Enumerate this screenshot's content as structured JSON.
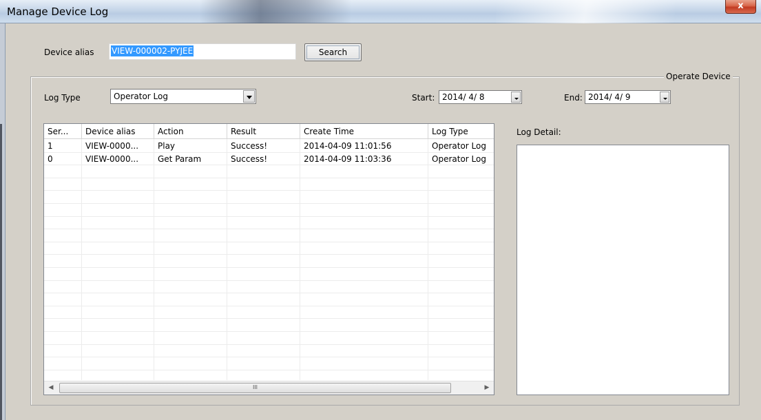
{
  "window": {
    "title": "Manage Device Log",
    "close_label": "x"
  },
  "device_alias": {
    "label": "Device alias",
    "value": "VIEW-000002-PYJEE",
    "search_label": "Search"
  },
  "group": {
    "title": "Operate Device"
  },
  "log_type": {
    "label": "Log Type",
    "selected": "Operator Log"
  },
  "start": {
    "label": "Start:",
    "value": "2014/ 4/ 8"
  },
  "end": {
    "label": "End:",
    "value": "2014/ 4/ 9"
  },
  "table": {
    "columns": [
      "Ser...",
      "Device alias",
      "Action",
      "Result",
      "Create Time",
      "Log Type"
    ],
    "rows": [
      [
        "1",
        "VIEW-0000...",
        "Play",
        "Success!",
        "2014-04-09 11:01:56",
        "Operator Log"
      ],
      [
        "0",
        "VIEW-0000...",
        "Get Param",
        "Success!",
        "2014-04-09 11:03:36",
        "Operator Log"
      ]
    ],
    "scroll_thumb_glyph": "III"
  },
  "log_detail": {
    "label": "Log Detail:",
    "value": ""
  },
  "colors": {
    "selection": "#3399ff",
    "background": "#d4d0c8",
    "close_button": "#c23b22"
  }
}
